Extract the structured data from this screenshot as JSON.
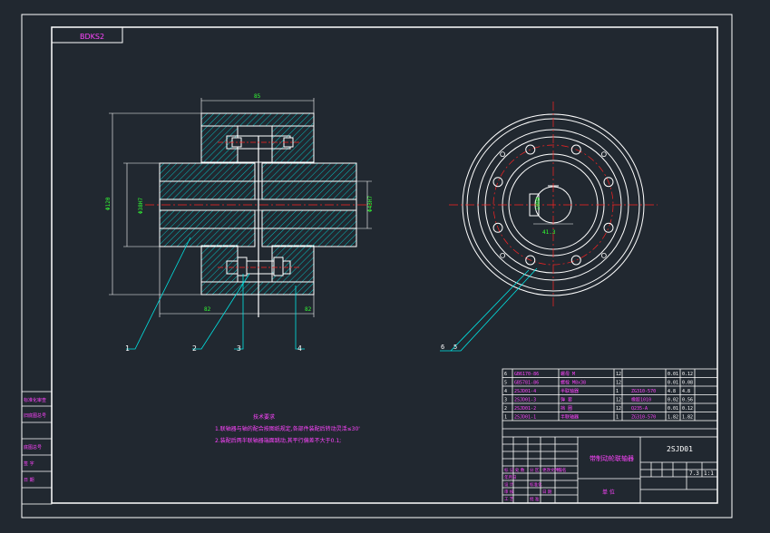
{
  "drawing": {
    "stamp_code": "BDKS2",
    "views": {
      "front": {
        "dim_top": "85",
        "dim_d_outer": "Φ120",
        "dim_d_inner": "Φ38H7",
        "dim_d_right": "Φ43H7",
        "dim_bottom_left": "82",
        "dim_bottom_right": "82"
      },
      "side": {
        "dim_keyway": "10N9",
        "dim_depth": "41.3"
      }
    },
    "balloons": [
      "1",
      "2",
      "3",
      "4",
      "6",
      "5"
    ],
    "tech_req": {
      "title": "技术要求",
      "line1": "1.联轴器与轴的配合按图纸规定,各部件装配后转动灵活≤30'",
      "line2": "2.装配后两半联轴器端面跳动,其平行偏差不大于0.1;"
    },
    "left_strip": [
      "标准化审查",
      "旧底图总号",
      "底图总号",
      "签 字",
      "日 期"
    ],
    "bom": [
      {
        "no": "6",
        "code": "GB6170-86",
        "name": "螺母 M",
        "qty": "12",
        "mat": "",
        "w1": "0.01",
        "w2": "0.12"
      },
      {
        "no": "5",
        "code": "GB5781-86",
        "name": "螺栓 M8x38",
        "qty": "12",
        "mat": "",
        "w1": "0.01",
        "w2": "0.08"
      },
      {
        "no": "4",
        "code": "2SJD01-4",
        "name": "半联轴器",
        "qty": "1",
        "mat": "ZG310-570",
        "w1": "4.8",
        "w2": "4.8"
      },
      {
        "no": "3",
        "code": "2SJD01-3",
        "name": "弹 套",
        "qty": "12",
        "mat": "橡胶1010",
        "w1": "0.02",
        "w2": "0.56"
      },
      {
        "no": "2",
        "code": "2SJD01-2",
        "name": "挡 圈",
        "qty": "12",
        "mat": "Q235-A",
        "w1": "0.01",
        "w2": "0.12"
      },
      {
        "no": "1",
        "code": "2SJD01-1",
        "name": "半联轴器",
        "qty": "1",
        "mat": "ZG310-570",
        "w1": "1.82",
        "w2": "1.82"
      }
    ],
    "title_block": {
      "title": "带制动轮联轴器",
      "drawing_no": "2SJD01",
      "scale": "1:1",
      "sheet": "7.3",
      "company": "单 位",
      "labels": [
        "标 记",
        "处 数",
        "分 区",
        "更改文件号",
        "签 名",
        "年月日",
        "设 计",
        "标准化",
        "审 核",
        "工 艺",
        "批 准",
        "日 期"
      ]
    },
    "colors": {
      "background": "#212830",
      "outline": "#ffffff",
      "hatch": "#00e5e5",
      "center": "#ff2222",
      "dimension": "#33ff33",
      "bom_text": "#ff44ff"
    }
  }
}
